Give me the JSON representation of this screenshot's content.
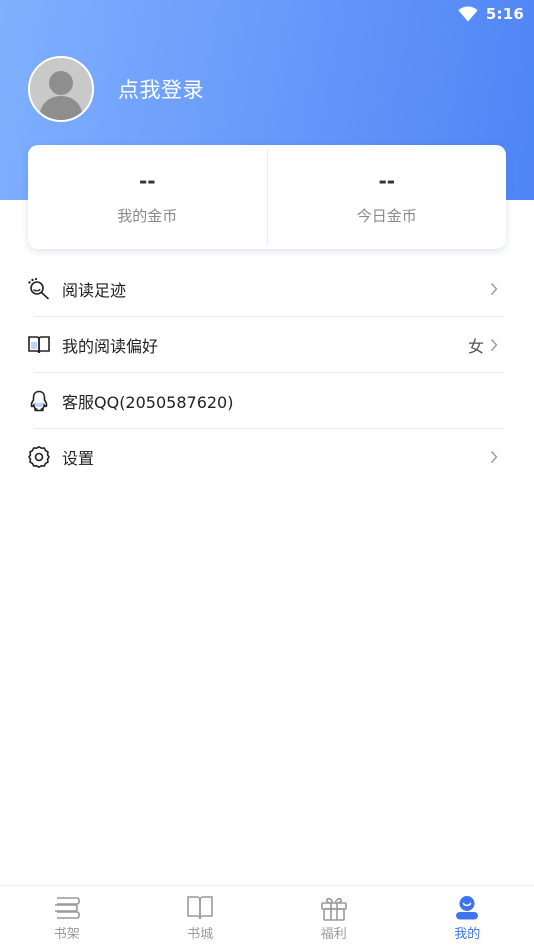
{
  "status_bar": {
    "time": "5:16",
    "wifi_icon": "wifi-icon"
  },
  "profile": {
    "avatar_icon": "default-avatar-icon",
    "login_text": "点我登录"
  },
  "coins": [
    {
      "value": "--",
      "label": "我的金币"
    },
    {
      "value": "--",
      "label": "今日金币"
    }
  ],
  "menu": [
    {
      "icon": "footprint-search-icon",
      "label": "阅读足迹",
      "value": "",
      "has_chevron": true
    },
    {
      "icon": "open-book-icon",
      "label": "我的阅读偏好",
      "value": "女",
      "has_chevron": true
    },
    {
      "icon": "qq-penguin-icon",
      "label": "客服QQ(2050587620)",
      "value": "",
      "has_chevron": false
    },
    {
      "icon": "gear-icon",
      "label": "设置",
      "value": "",
      "has_chevron": true
    }
  ],
  "tabs": [
    {
      "icon": "bookshelf-icon",
      "label": "书架",
      "active": false
    },
    {
      "icon": "book-icon",
      "label": "书城",
      "active": false
    },
    {
      "icon": "gift-icon",
      "label": "福利",
      "active": false
    },
    {
      "icon": "user-icon",
      "label": "我的",
      "active": true
    }
  ],
  "colors": {
    "accent": "#3f74ee",
    "hero_start": "#7fb0ff",
    "hero_end": "#4f84f5",
    "inactive_tab": "#9a9a9a"
  }
}
